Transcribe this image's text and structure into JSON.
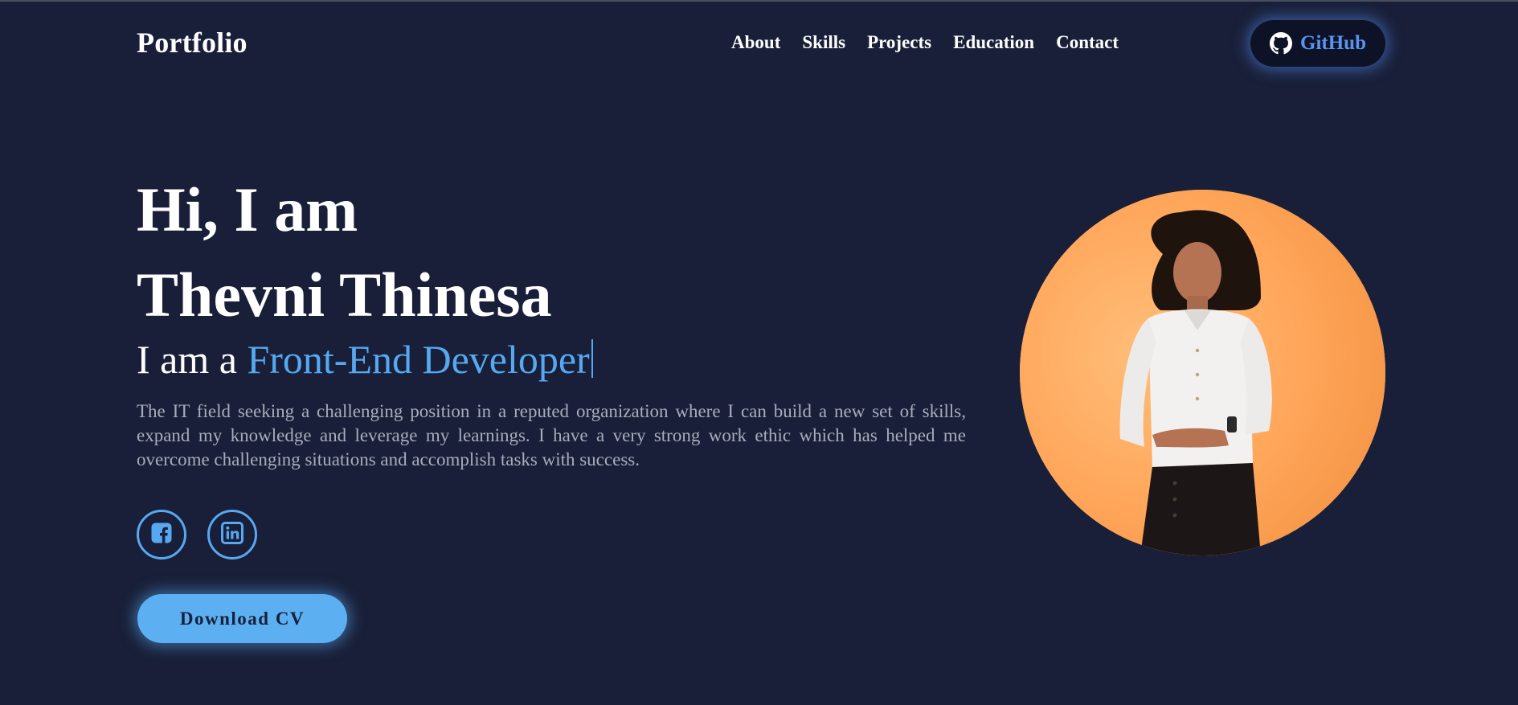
{
  "nav": {
    "logo": "Portfolio",
    "links": [
      "About",
      "Skills",
      "Projects",
      "Education",
      "Contact"
    ],
    "github_label": "GitHub",
    "github_icon": "github-icon"
  },
  "hero": {
    "title_line1": "Hi, I am",
    "title_line2": "Thevni Thinesa",
    "role_prefix": "I am a ",
    "role_accent": "Front-End Developer",
    "description": "The IT field seeking a challenging position in a reputed organization where I can build a new set of skills, expand my knowledge and leverage my learnings. I have a very strong work ethic which has helped me overcome challenging situations and accomplish tasks with success.",
    "socials": [
      "facebook-icon",
      "linkedin-icon"
    ],
    "cv_button": "Download CV",
    "photo_alt": "profile-photo"
  },
  "colors": {
    "background": "#191f38",
    "accent": "#56a9f0",
    "text": "#ffffff",
    "muted": "#a8adbc",
    "github_label": "#5a94ee"
  }
}
